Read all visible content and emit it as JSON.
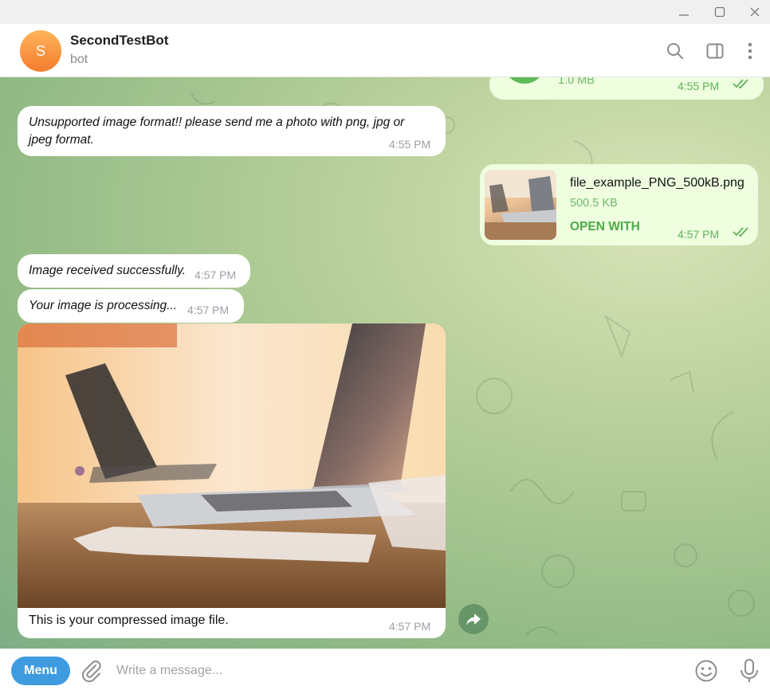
{
  "window": {
    "controls": [
      "minimize",
      "maximize",
      "close"
    ]
  },
  "header": {
    "avatar_letter": "S",
    "title": "SecondTestBot",
    "subtitle": "bot",
    "icons": [
      "search-icon",
      "sidebar-toggle-icon",
      "more-icon"
    ]
  },
  "messages": {
    "top_file": {
      "size": "1.0 MB",
      "time": "4:55 PM"
    },
    "unsupported": {
      "text": "Unsupported image format!! please send me a photo with png, jpg or jpeg format.",
      "time": "4:55 PM"
    },
    "file": {
      "name": "file_example_PNG_500kB.png",
      "size": "500.5 KB",
      "action": "OPEN WITH",
      "time": "4:57 PM"
    },
    "received": {
      "text": "Image received successfully.",
      "time": "4:57 PM"
    },
    "processing": {
      "text": "Your image is processing...",
      "time": "4:57 PM"
    },
    "photo": {
      "caption": "This is your compressed image file.",
      "time": "4:57 PM"
    }
  },
  "composer": {
    "menu_label": "Menu",
    "placeholder": "Write a message..."
  },
  "colors": {
    "incoming_bubble": "#ffffff",
    "outgoing_bubble": "#eefedf",
    "accent": "#3e9be0",
    "outgoing_text": "#4daa4a"
  }
}
